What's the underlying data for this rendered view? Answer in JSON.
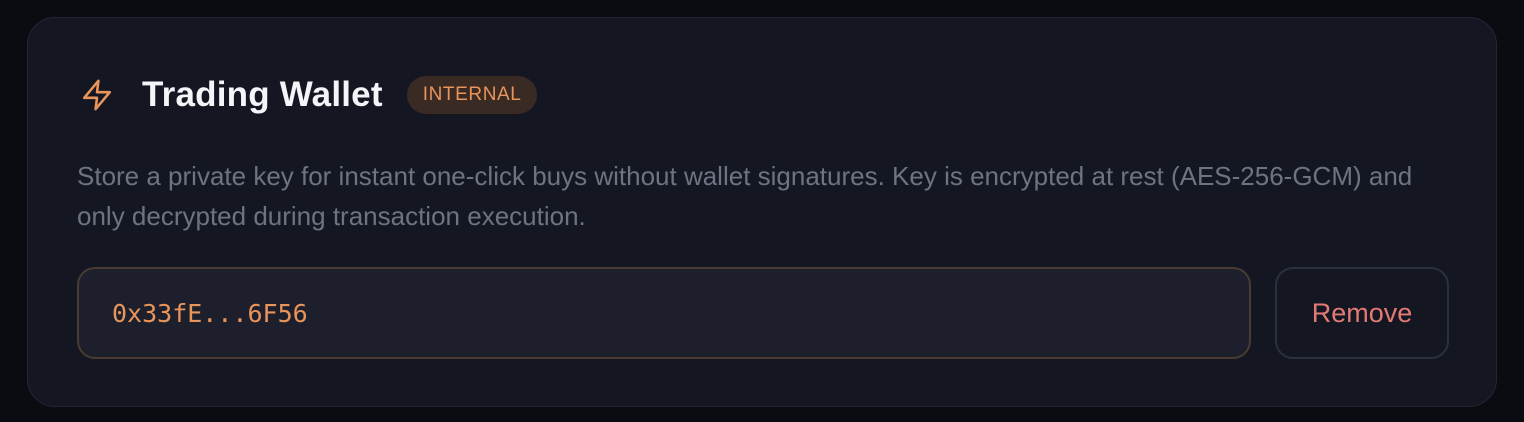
{
  "wallet": {
    "icon": "lightning-bolt-icon",
    "title": "Trading Wallet",
    "badge": "INTERNAL",
    "description": "Store a private key for instant one-click buys without wallet signatures. Key is encrypted at rest (AES-256-GCM) and only decrypted during transaction execution.",
    "key_value": "0x33fE...6F56",
    "remove_label": "Remove"
  },
  "colors": {
    "background": "#0b0b12",
    "card": "#141722",
    "accent": "#e8945a",
    "danger": "#e27a74",
    "badge_bg": "#3a2a24",
    "muted_text": "#6e7384"
  }
}
